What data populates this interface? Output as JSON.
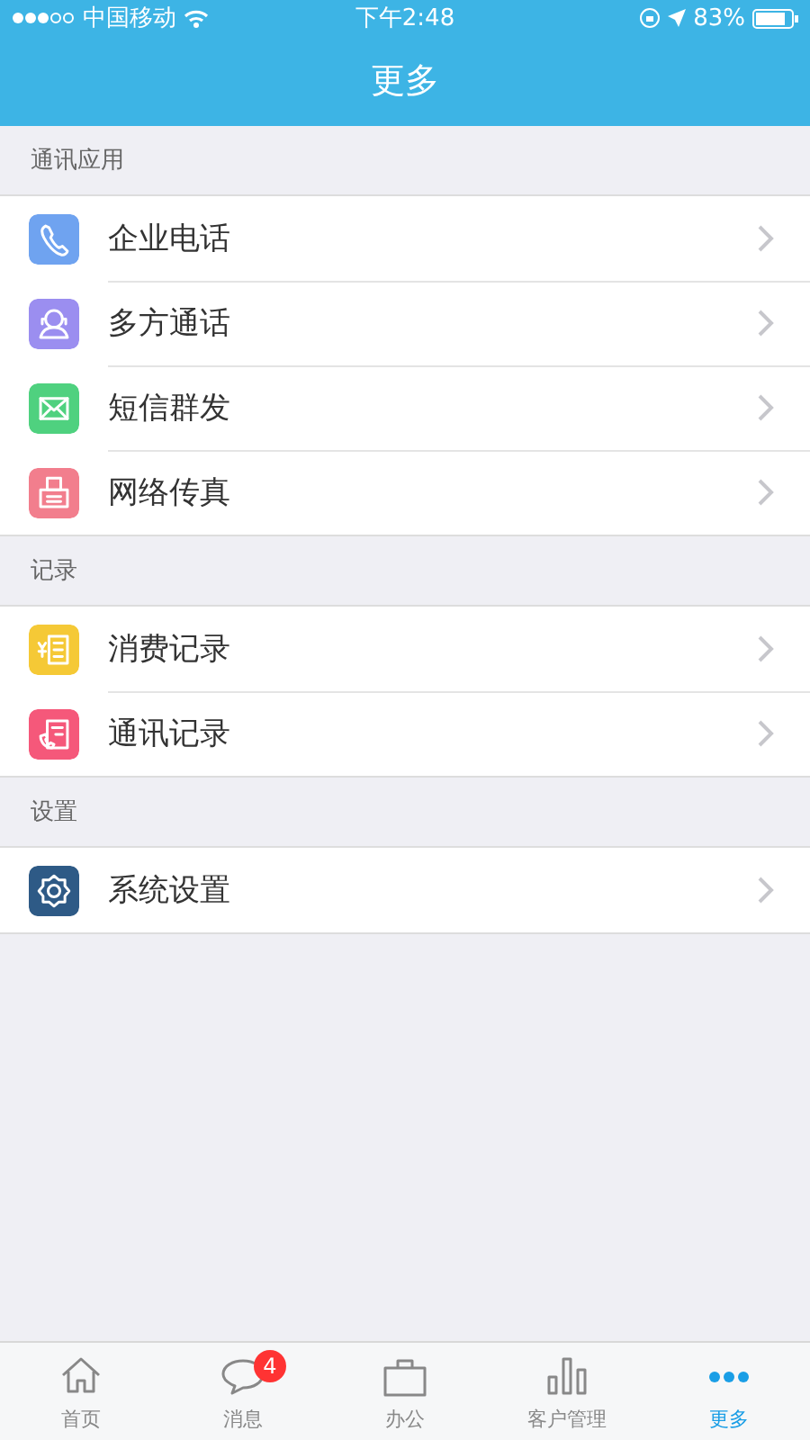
{
  "status_bar": {
    "carrier": "中国移动",
    "time": "下午2:48",
    "battery": "83%"
  },
  "nav": {
    "title": "更多"
  },
  "sections": [
    {
      "title": "通讯应用",
      "items": [
        {
          "label": "企业电话",
          "kind": "phone",
          "color": "#6fa3f0"
        },
        {
          "label": "多方通话",
          "kind": "conference",
          "color": "#9b8ef0"
        },
        {
          "label": "短信群发",
          "kind": "mail",
          "color": "#4fd17f"
        },
        {
          "label": "网络传真",
          "kind": "fax",
          "color": "#f27e8d"
        }
      ]
    },
    {
      "title": "记录",
      "items": [
        {
          "label": "消费记录",
          "kind": "receipt",
          "color": "#f5c936"
        },
        {
          "label": "通讯记录",
          "kind": "calllog",
          "color": "#f5587a"
        }
      ]
    },
    {
      "title": "设置",
      "items": [
        {
          "label": "系统设置",
          "kind": "gear",
          "color": "#2e5a86"
        }
      ]
    }
  ],
  "tab_bar": [
    {
      "label": "首页",
      "kind": "home",
      "selected": false
    },
    {
      "label": "消息",
      "kind": "chat",
      "selected": false,
      "badge": "4"
    },
    {
      "label": "办公",
      "kind": "briefcase",
      "selected": false
    },
    {
      "label": "客户管理",
      "kind": "bars",
      "selected": false
    },
    {
      "label": "更多",
      "kind": "dots",
      "selected": true
    }
  ]
}
